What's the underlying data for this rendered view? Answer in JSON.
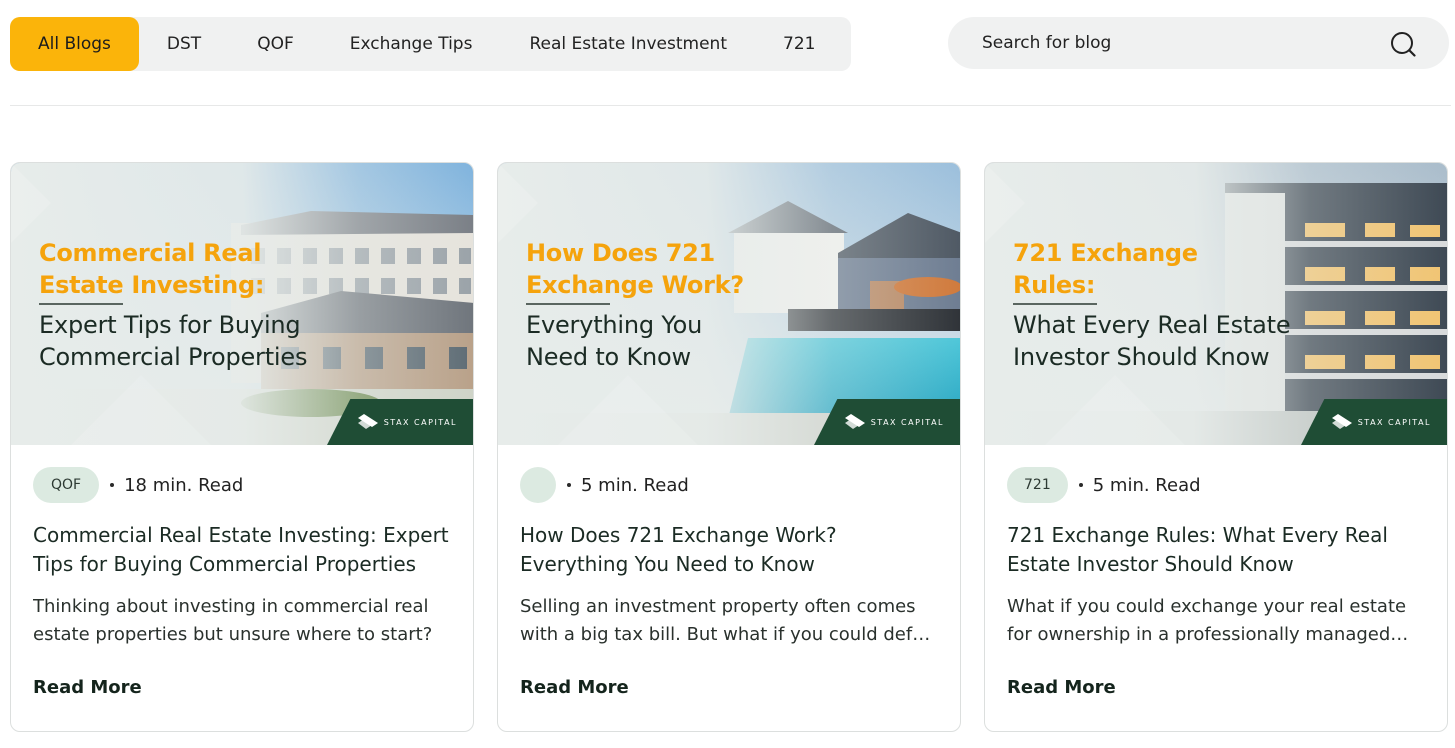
{
  "filters": {
    "tabs": [
      {
        "label": "All Blogs",
        "active": true
      },
      {
        "label": "DST",
        "active": false
      },
      {
        "label": "QOF",
        "active": false
      },
      {
        "label": "Exchange Tips",
        "active": false
      },
      {
        "label": "Real Estate Investment",
        "active": false
      },
      {
        "label": "721",
        "active": false
      }
    ]
  },
  "search": {
    "placeholder": "Search for blog",
    "icon": "search-icon"
  },
  "colors": {
    "accent": "#fbb40a",
    "brand_green": "#1f4d35",
    "headline_orange": "#f5a30c",
    "pill_bg": "#dceae1"
  },
  "cards": [
    {
      "banner": {
        "headline": "Commercial Real\nEstate Investing:",
        "subhead": "Expert Tips for Buying\nCommercial Properties",
        "brand": "STAX CAPITAL"
      },
      "tag": "QOF",
      "read_time": "18 min. Read",
      "title": "Commercial Real Estate Investing: Expert Tips for Buying Commercial Properties",
      "excerpt": "Thinking about investing in commercial real estate properties but unsure where to start?",
      "cta": "Read More"
    },
    {
      "banner": {
        "headline": "How Does 721\nExchange Work?",
        "subhead": "Everything You\nNeed to Know",
        "brand": "STAX CAPITAL"
      },
      "tag": "",
      "read_time": "5 min. Read",
      "title": "How Does 721 Exchange Work? Everything You Need to Know",
      "excerpt": "Selling an investment property often comes with a big tax bill. But what if you could defer it?",
      "cta": "Read More"
    },
    {
      "banner": {
        "headline": "721 Exchange\nRules:",
        "subhead": "What Every Real Estate\nInvestor Should Know",
        "brand": "STAX CAPITAL"
      },
      "tag": "721",
      "read_time": "5 min. Read",
      "title": "721 Exchange Rules: What Every Real Estate Investor Should Know",
      "excerpt": "What if you could exchange your real estate for ownership in a professionally managed portfolio?",
      "cta": "Read More"
    }
  ]
}
